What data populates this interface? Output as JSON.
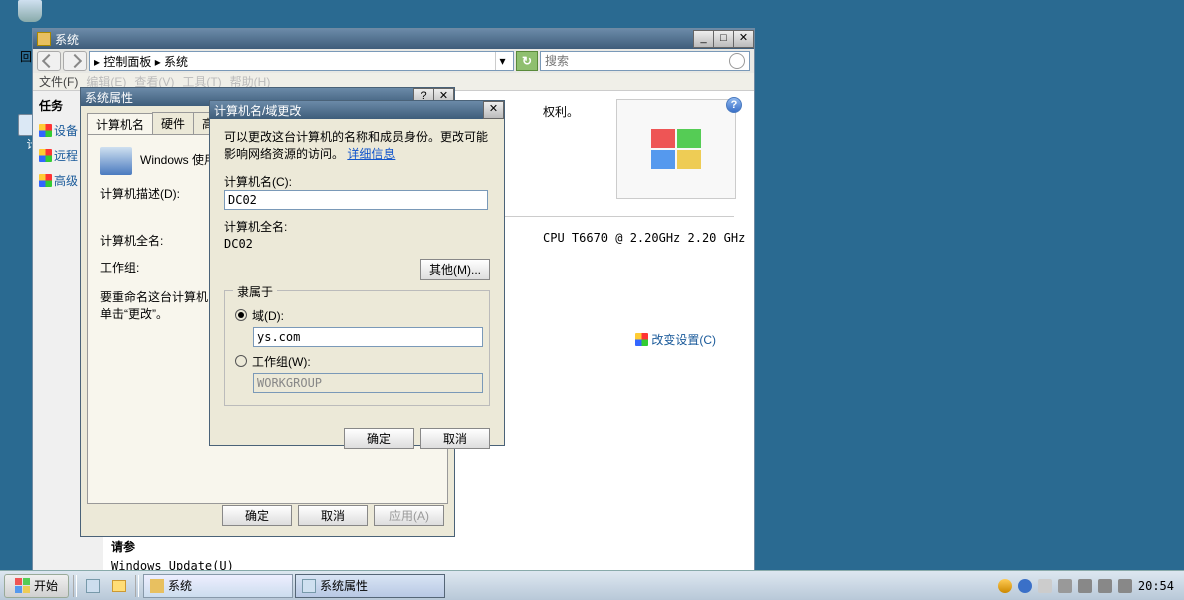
{
  "desktop": {
    "return_label": "回",
    "computer_label": "计"
  },
  "explorer": {
    "title": "系统",
    "breadcrumb": "▸ 控制面板 ▸ 系统",
    "search_placeholder": "搜索",
    "menu": {
      "file": "文件(F)",
      "edit": "编辑(E)",
      "view": "查看(V)",
      "tools": "工具(T)",
      "help": "帮助(H)"
    },
    "tasks_header": "任务",
    "tasks": {
      "device": "设备",
      "remote": "远程",
      "advanced": "高级"
    },
    "rights_suffix": "权利。",
    "cpu_line": "CPU    T6670  @ 2.20GHz   2.20 GHz",
    "change_settings": "改变设置(C)",
    "see_also": "请参",
    "winupdate": "Windows Update(U)",
    "help": "?"
  },
  "sysprop": {
    "title": "系统属性",
    "tabs": {
      "name": "计算机名",
      "hardware": "硬件",
      "advanced": "高级"
    },
    "uses": "Windows 使用",
    "desc_label": "计算机描述(D):",
    "fullname_label": "计算机全名:",
    "workgroup_label": "工作组:",
    "rename_text": "要重命名这台计算机，单击“更改”。",
    "ok": "确定",
    "cancel": "取消",
    "apply": "应用(A)"
  },
  "namedlg": {
    "title": "计算机名/域更改",
    "info": "可以更改这台计算机的名称和成员身份。更改可能影响网络资源的访问。",
    "info_link": "详细信息",
    "name_label": "计算机名(C):",
    "name_value": "DC02",
    "fullname_label": "计算机全名:",
    "fullname_value": "DC02",
    "more": "其他(M)...",
    "member_of": "隶属于",
    "domain_label": "域(D):",
    "domain_value": "ys.com",
    "workgroup_label": "工作组(W):",
    "workgroup_value": "WORKGROUP",
    "ok": "确定",
    "cancel": "取消"
  },
  "taskbar": {
    "start": "开始",
    "task_system": "系统",
    "task_sysprop": "系统属性",
    "clock": "20:54"
  }
}
